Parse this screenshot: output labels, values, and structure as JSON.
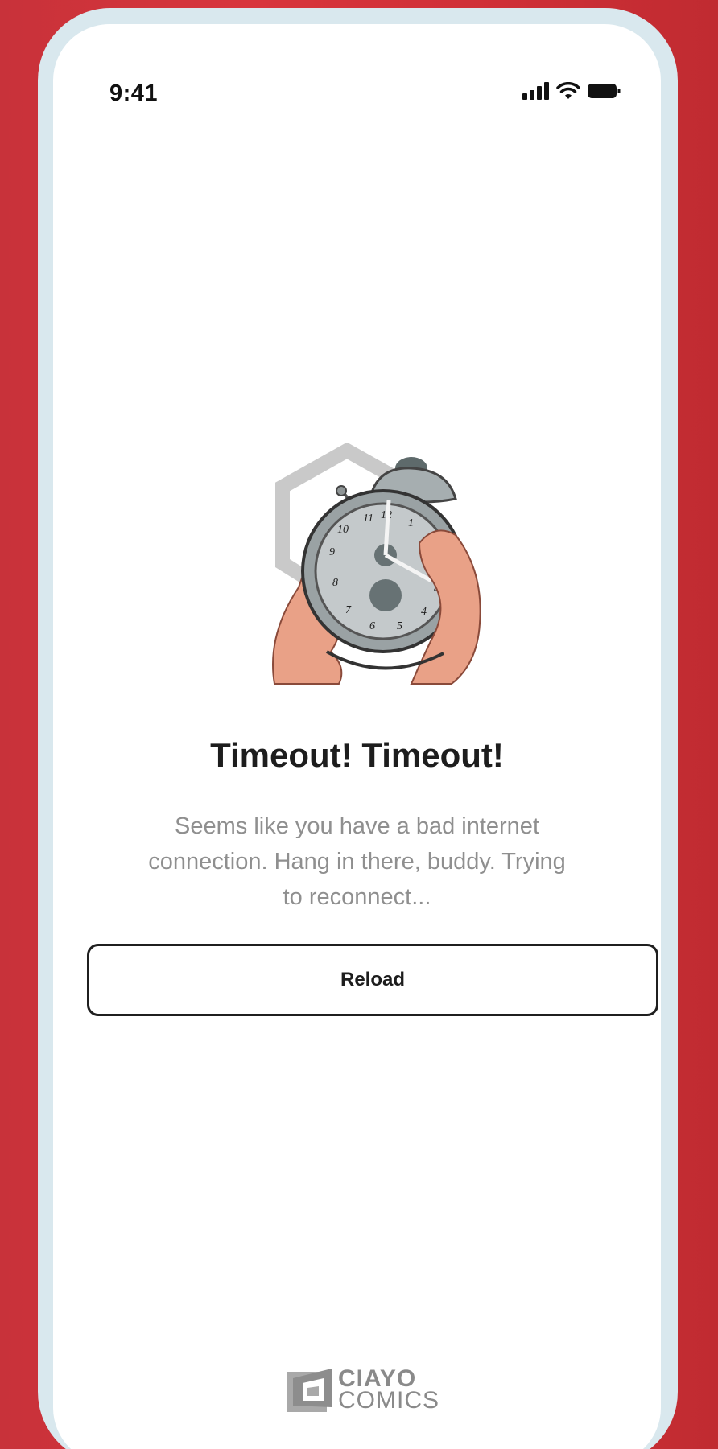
{
  "status_bar": {
    "time": "9:41",
    "icons": [
      "cellular-signal-icon",
      "wifi-icon",
      "battery-icon"
    ]
  },
  "illustration": {
    "name": "alarm-clock-in-hands-illustration",
    "clock_numbers": [
      "11",
      "12",
      "1",
      "10",
      "9",
      "8",
      "7",
      "6",
      "5",
      "4",
      "3"
    ]
  },
  "error": {
    "title": "Timeout! Timeout!",
    "message": "Seems like you have a bad internet connection. Hang in there, buddy. Trying to reconnect..."
  },
  "actions": {
    "reload_label": "Reload"
  },
  "brand": {
    "line1": "CIAYO",
    "line2": "COMICS"
  },
  "colors": {
    "background_red": "#d8353c",
    "frame": "#d9e8ee",
    "screen": "#ffffff",
    "title_text": "#1d1d1d",
    "body_text": "#8f8f8f",
    "button_border": "#1f1f1f",
    "brand_gray": "#8a8a8a"
  }
}
